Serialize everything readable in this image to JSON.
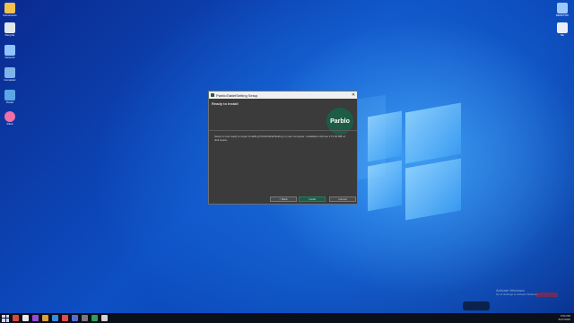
{
  "desktop": {
    "left_icons": [
      {
        "label": "Documents",
        "color": "#f2c14e"
      },
      {
        "label": "Recycle",
        "color": "#dfe6ee"
      },
      {
        "label": "Network",
        "color": "#8fc4ff"
      },
      {
        "label": "Computer",
        "color": "#7fb4e8"
      },
      {
        "label": "Panel",
        "color": "#5aa6e6"
      },
      {
        "label": "Paint",
        "color": "#f06fa8"
      }
    ],
    "right_icons": [
      {
        "label": "DESKTOP",
        "color": "#9ec9ff"
      },
      {
        "label": "file",
        "color": "#e9eef7"
      }
    ]
  },
  "installer": {
    "window_title": "ParbloTabletSetting Setup",
    "close_glyph": "✕",
    "header_title": "Ready to Install",
    "brand": "Parblo",
    "body_text": "Setup is now ready to begin installing ParbloTabletSetting on your computer. Installation will use 171.34 MB of disk space.",
    "buttons": {
      "back": "< Back",
      "install": "Install",
      "cancel": "Cancel"
    },
    "accent": "#1d5c45"
  },
  "watermark": {
    "line1": "Activate Windows",
    "line2": "Go to Settings to activate Windows."
  },
  "taskbar": {
    "app_colors": [
      "#d84a3a",
      "#e8e8e8",
      "#9a4bd6",
      "#d9a23a",
      "#3a8be0",
      "#e34d4d",
      "#5b6bd6",
      "#7a7a7a",
      "#2f9e57",
      "#d3d3d3"
    ],
    "time": "3:52 PM",
    "date": "5/27/2020"
  }
}
